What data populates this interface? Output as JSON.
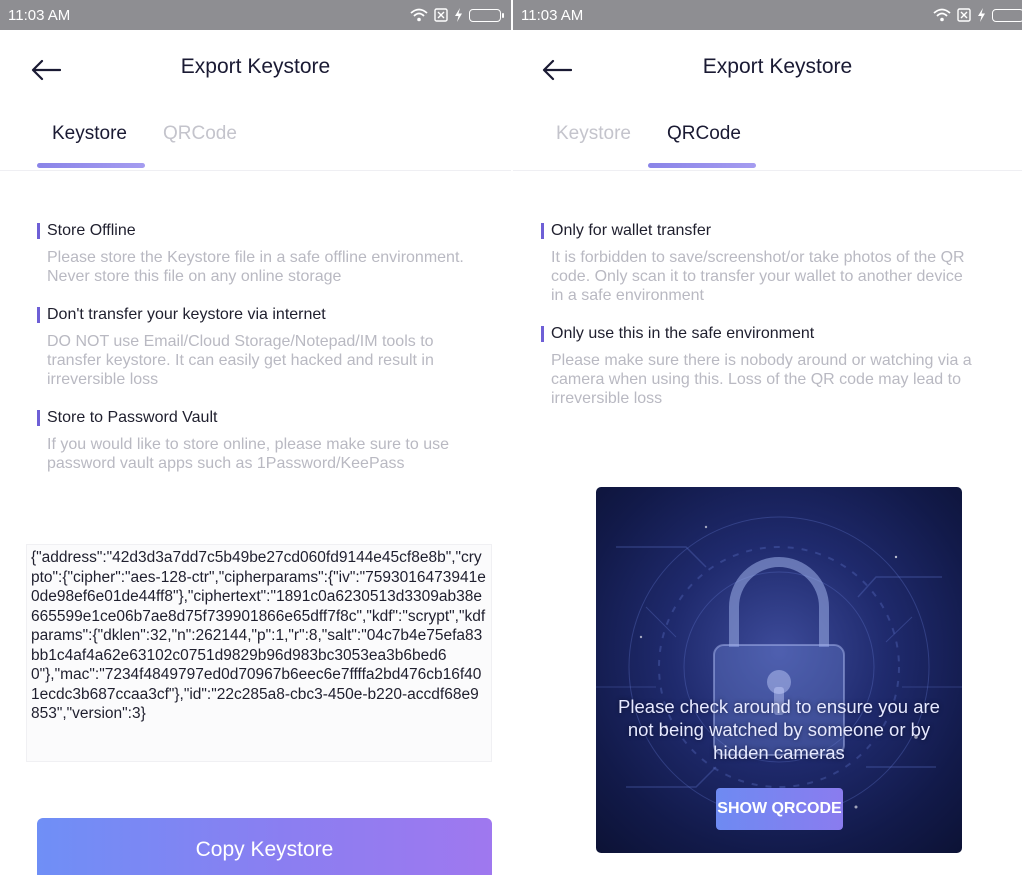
{
  "status_bar": {
    "time": "11:03 AM",
    "icons": [
      "wifi-icon",
      "sim-icon",
      "charging-icon",
      "battery-icon"
    ],
    "battery_color": "#3ed14e"
  },
  "header": {
    "title": "Export Keystore",
    "back_icon": "arrow-left-icon"
  },
  "tabs": [
    {
      "label": "Keystore"
    },
    {
      "label": "QRCode"
    }
  ],
  "keystore_screen": {
    "active_tab": "Keystore",
    "notices": [
      {
        "title": "Store Offline",
        "body": "Please store the Keystore file in a safe offline environment. Never store this file on any online storage"
      },
      {
        "title": "Don't transfer your keystore via internet",
        "body": "DO NOT use Email/Cloud Storage/Notepad/IM tools to transfer keystore. It can easily get hacked and result in irreversible loss"
      },
      {
        "title": "Store to Password Vault",
        "body": "If you would like to store online, please make sure to use password vault apps such as 1Password/KeePass"
      }
    ],
    "keystore_json": "{\"address\":\"42d3d3a7dd7c5b49be27cd060fd9144e45cf8e8b\",\"crypto\":{\"cipher\":\"aes-128-ctr\",\"cipherparams\":{\"iv\":\"7593016473941e0de98ef6e01de44ff8\"},\"ciphertext\":\"1891c0a6230513d3309ab38e665599e1ce06b7ae8d75f739901866e65dff7f8c\",\"kdf\":\"scrypt\",\"kdfparams\":{\"dklen\":32,\"n\":262144,\"p\":1,\"r\":8,\"salt\":\"04c7b4e75efa83bb1c4af4a62e63102c0751d9829b96d983bc3053ea3b6bed60\"},\"mac\":\"7234f4849797ed0d70967b6eec6e7ffffa2bd476cb16f401ecdc3b687ccaa3cf\"},\"id\":\"22c285a8-cbc3-450e-b220-accdf68e9853\",\"version\":3}",
    "copy_button_label": "Copy Keystore"
  },
  "qrcode_screen": {
    "active_tab": "QRCode",
    "notices": [
      {
        "title": "Only for wallet transfer",
        "body": "It is forbidden to save/screenshot/or take photos of the QR code. Only scan it to transfer your wallet to another device in a safe environment"
      },
      {
        "title": "Only use this in the safe environment",
        "body": "Please make sure there is nobody around or watching via a camera when using this. Loss of the QR code may lead to irreversible loss"
      }
    ],
    "warning_text": "Please check around to ensure you are not being watched by someone or by hidden cameras",
    "show_button_label": "SHOW QRCODE",
    "panel_icon": "padlock-icon"
  },
  "colors": {
    "accent": "#6e5fd6",
    "title_text": "#1a1a33",
    "muted_text": "#b9b9c2",
    "inactive_tab": "#c4c4cc",
    "status_bar": "#8e8e92"
  }
}
